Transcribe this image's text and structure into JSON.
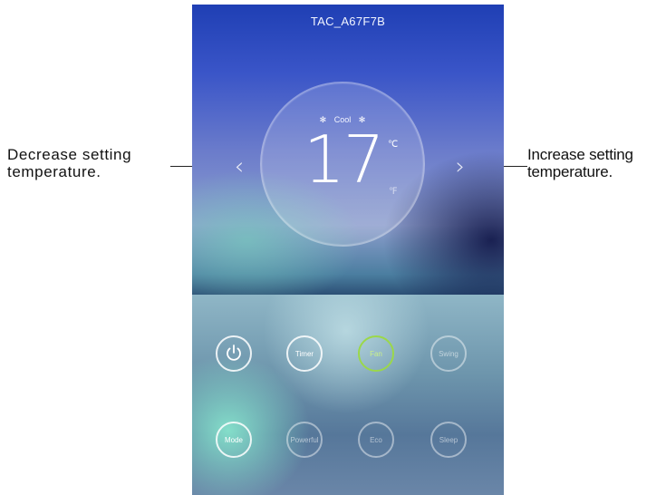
{
  "annotations": {
    "left": [
      "Decrease setting",
      "temperature."
    ],
    "right": [
      "Increase setting",
      "temperature."
    ]
  },
  "app": {
    "device_name": "TAC_A67F7B",
    "mode": "Cool",
    "temperature": "17",
    "unit_c": "℃",
    "unit_f": "℉",
    "decrease_glyph": "‹",
    "increase_glyph": "›"
  },
  "buttons": {
    "row1": [
      {
        "name": "power",
        "label": "",
        "icon": "power-icon",
        "state": "on"
      },
      {
        "name": "timer",
        "label": "Timer",
        "state": "normal"
      },
      {
        "name": "fan",
        "label": "Fan",
        "state": "active",
        "accent": "#9bd84a"
      },
      {
        "name": "swing",
        "label": "Swing",
        "state": "dim"
      }
    ],
    "row2": [
      {
        "name": "mode",
        "label": "Mode",
        "state": "normal"
      },
      {
        "name": "powerful",
        "label": "Powerful",
        "state": "dim"
      },
      {
        "name": "eco",
        "label": "Eco",
        "state": "dim"
      },
      {
        "name": "sleep",
        "label": "Sleep",
        "state": "dim"
      }
    ]
  }
}
